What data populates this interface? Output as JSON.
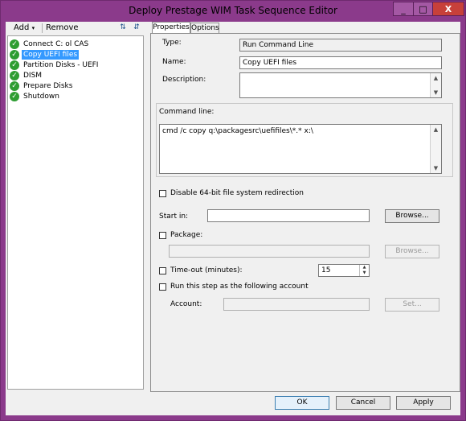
{
  "window": {
    "title": "Deploy Prestage WIM Task Sequence Editor",
    "minimize_glyph": "_",
    "maximize_glyph": "□",
    "close_glyph": "X"
  },
  "toolbar": {
    "add_label": "Add",
    "add_arrow": "▾",
    "remove_label": "Remove",
    "move_up_icon": "move-up-icon",
    "move_down_icon": "move-down-icon"
  },
  "tree": {
    "items": [
      {
        "label": "Connect C: ol CAS",
        "selected": false
      },
      {
        "label": "Copy UEFI files",
        "selected": true
      },
      {
        "label": "Partition Disks - UEFI",
        "selected": false
      },
      {
        "label": "DISM",
        "selected": false
      },
      {
        "label": "Prepare Disks",
        "selected": false
      },
      {
        "label": "Shutdown",
        "selected": false
      }
    ],
    "check_glyph": "✓"
  },
  "tabs": {
    "properties": "Properties",
    "options": "Options"
  },
  "properties": {
    "type_label": "Type:",
    "type_value": "Run Command Line",
    "name_label": "Name:",
    "name_value": "Copy UEFI files",
    "description_label": "Description:",
    "description_value": "",
    "command_line_label": "Command line:",
    "command_line_value": "cmd /c copy q:\\packagesrc\\uefifiles\\*.* x:\\",
    "disable_64bit_label": "Disable 64-bit file system redirection",
    "start_in_label": "Start in:",
    "start_in_value": "",
    "browse_label": "Browse...",
    "package_label": "Package:",
    "package_value": "",
    "package_browse_label": "Browse...",
    "timeout_label": "Time-out (minutes):",
    "timeout_value": "15",
    "run_as_label": "Run this step as the following account",
    "account_label": "Account:",
    "account_value": "",
    "set_label": "Set..."
  },
  "buttons": {
    "ok": "OK",
    "cancel": "Cancel",
    "apply": "Apply"
  },
  "colors": {
    "titlebar": "#8b3a8b",
    "selection": "#3399ff",
    "check_green": "#2e9d32"
  }
}
